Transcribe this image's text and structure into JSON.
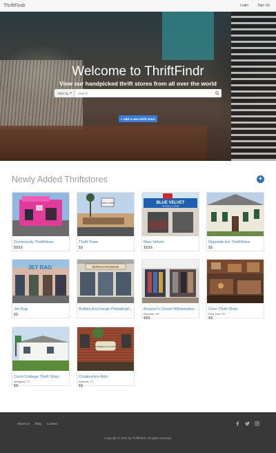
{
  "navbar": {
    "brand": "ThriftFindr",
    "login": "Login",
    "signup": "Sign Up"
  },
  "hero": {
    "title": "Welcome to ThriftFindr",
    "subtitle": "View our handpicked thrift stores from all over the world"
  },
  "search": {
    "filter_label": "Filter by",
    "placeholder": "Search"
  },
  "add_store_label": "+ add a new thrift store",
  "section_title": "Newly Added Thriftstores",
  "stores": [
    {
      "name": "Community ThriftStore",
      "location": "",
      "price": "$$$$"
    },
    {
      "name": "Thrift Town",
      "location": "",
      "price": "$$"
    },
    {
      "name": "Blue Velvet",
      "location": "",
      "price": "$$$$"
    },
    {
      "name": "Wayside Inn ThriftStore",
      "location": "",
      "price": "$$"
    },
    {
      "name": "Jet Rag",
      "location": "",
      "price": "$$"
    },
    {
      "name": "Buffalo Exchange Philadelph...",
      "location": "",
      "price": ""
    },
    {
      "name": "Beacon's Closet Williamsbur...",
      "location": "Brooklyn, NY",
      "price": "$$$"
    },
    {
      "name": "Cure Thrift Shop",
      "location": "New York, NY",
      "price": "$$"
    },
    {
      "name": "Curio Cottage Thrift Shop",
      "location": "Westport, CT",
      "price": "$$"
    },
    {
      "name": "Cinderella's Attic",
      "location": "Guilford, CT",
      "price": "$$"
    }
  ],
  "photo_signs": {
    "blue_velvet": "BLUE VELVET",
    "blue_velvet_sub": "VINTAGE CLOTHING",
    "thrift_town": "THRIFT TOWN",
    "jet_rag": "JET RAG",
    "buffalo": "BUFFALO EXCHANGE",
    "cinderella": "CINDERELLA'S ATTIC"
  },
  "footer": {
    "links": [
      "About us",
      "Blog",
      "Contact"
    ],
    "social_icons": [
      "facebook-icon",
      "twitter-icon",
      "instagram-icon"
    ],
    "copyright": "Copyright © 2017 by ThriftFindr. All rights reserved."
  },
  "colors": {
    "accent": "#3a7bd5",
    "link": "#3a7bb5",
    "footer": "#383838"
  }
}
